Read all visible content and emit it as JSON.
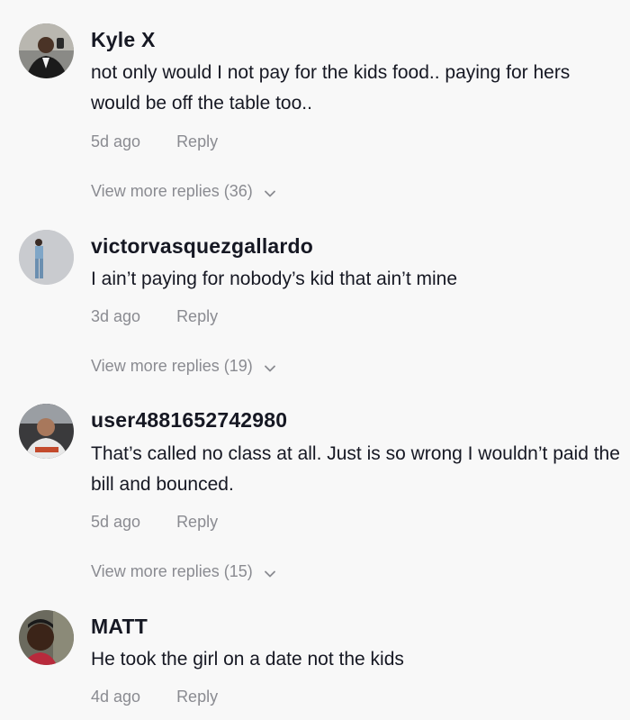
{
  "comments": [
    {
      "username": "Kyle X",
      "text": "not only would I not pay for the kids food.. paying for hers would be off the table too..",
      "time": "5d ago",
      "reply_label": "Reply",
      "view_more": "View more replies (36)"
    },
    {
      "username": "victorvasquezgallardo",
      "text": "I ain’t paying for nobody’s kid that ain’t mine",
      "time": "3d ago",
      "reply_label": "Reply",
      "view_more": "View more replies (19)"
    },
    {
      "username": "user4881652742980",
      "text": "That’s called no class at all. Just is so wrong I wouldn’t paid the bill and bounced.",
      "time": "5d ago",
      "reply_label": "Reply",
      "view_more": "View more replies (15)"
    },
    {
      "username": "MATT",
      "text": "He took the girl on a date not the kids",
      "time": "4d ago",
      "reply_label": "Reply"
    }
  ],
  "colors": {
    "background": "#f8f8f8",
    "username": "#161823",
    "meta": "#8a8b91"
  },
  "icons": {
    "expand": "chevron-down-icon"
  }
}
